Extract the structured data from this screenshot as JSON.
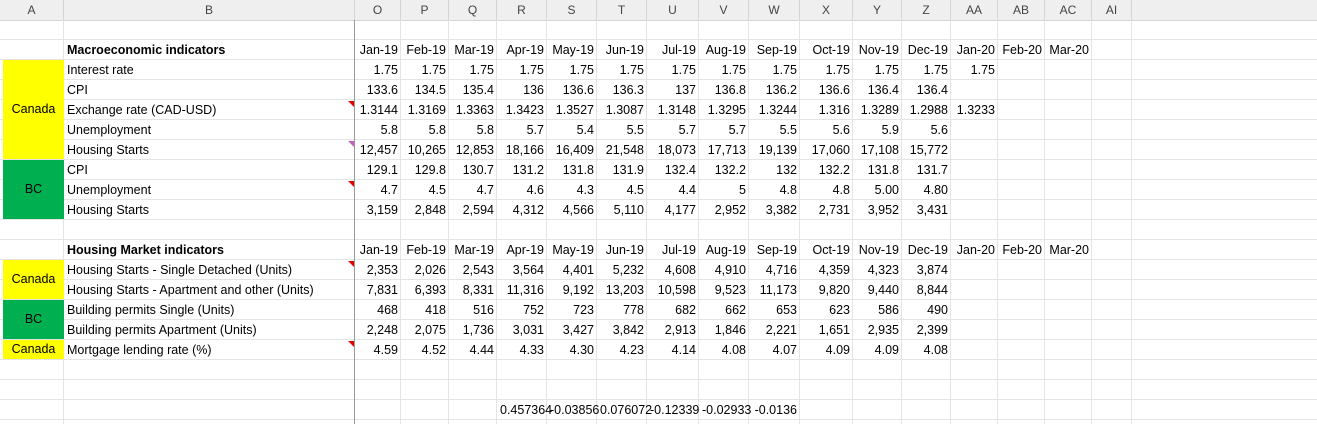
{
  "column_headers": [
    "A",
    "B",
    "O",
    "P",
    "Q",
    "R",
    "S",
    "T",
    "U",
    "V",
    "W",
    "X",
    "Y",
    "Z",
    "AA",
    "AB",
    "AC",
    "AI"
  ],
  "macro": {
    "title": "Macroeconomic indicators",
    "months": [
      "Jan-19",
      "Feb-19",
      "Mar-19",
      "Apr-19",
      "May-19",
      "Jun-19",
      "Jul-19",
      "Aug-19",
      "Sep-19",
      "Oct-19",
      "Nov-19",
      "Dec-19",
      "Jan-20",
      "Feb-20",
      "Mar-20"
    ],
    "regions": [
      "Canada",
      "BC"
    ],
    "rows": [
      {
        "label": "Interest rate",
        "values": [
          "1.75",
          "1.75",
          "1.75",
          "1.75",
          "1.75",
          "1.75",
          "1.75",
          "1.75",
          "1.75",
          "1.75",
          "1.75",
          "1.75",
          "1.75",
          "",
          ""
        ]
      },
      {
        "label": "CPI",
        "values": [
          "133.6",
          "134.5",
          "135.4",
          "136",
          "136.6",
          "136.3",
          "137",
          "136.8",
          "136.2",
          "136.6",
          "136.4",
          "136.4",
          "",
          "",
          ""
        ]
      },
      {
        "label": "Exchange rate (CAD-USD)",
        "values": [
          "1.3144",
          "1.3169",
          "1.3363",
          "1.3423",
          "1.3527",
          "1.3087",
          "1.3148",
          "1.3295",
          "1.3244",
          "1.316",
          "1.3289",
          "1.2988",
          "1.3233",
          "",
          ""
        ]
      },
      {
        "label": "Unemployment",
        "values": [
          "5.8",
          "5.8",
          "5.8",
          "5.7",
          "5.4",
          "5.5",
          "5.7",
          "5.7",
          "5.5",
          "5.6",
          "5.9",
          "5.6",
          "",
          "",
          ""
        ]
      },
      {
        "label": "Housing Starts",
        "values": [
          "12,457",
          "10,265",
          "12,853",
          "18,166",
          "16,409",
          "21,548",
          "18,073",
          "17,713",
          "19,139",
          "17,060",
          "17,108",
          "15,772",
          "",
          "",
          ""
        ]
      },
      {
        "label": "CPI",
        "values": [
          "129.1",
          "129.8",
          "130.7",
          "131.2",
          "131.8",
          "131.9",
          "132.4",
          "132.2",
          "132",
          "132.2",
          "131.8",
          "131.7",
          "",
          "",
          ""
        ]
      },
      {
        "label": "Unemployment",
        "values": [
          "4.7",
          "4.5",
          "4.7",
          "4.6",
          "4.3",
          "4.5",
          "4.4",
          "5",
          "4.8",
          "4.8",
          "5.00",
          "4.80",
          "",
          "",
          ""
        ]
      },
      {
        "label": "Housing Starts",
        "values": [
          "3,159",
          "2,848",
          "2,594",
          "4,312",
          "4,566",
          "5,110",
          "4,177",
          "2,952",
          "3,382",
          "2,731",
          "3,952",
          "3,431",
          "",
          "",
          ""
        ]
      }
    ]
  },
  "housing": {
    "title": "Housing Market indicators",
    "months": [
      "Jan-19",
      "Feb-19",
      "Mar-19",
      "Apr-19",
      "May-19",
      "Jun-19",
      "Jul-19",
      "Aug-19",
      "Sep-19",
      "Oct-19",
      "Nov-19",
      "Dec-19",
      "Jan-20",
      "Feb-20",
      "Mar-20"
    ],
    "regions": [
      "Canada",
      "BC",
      "Canada"
    ],
    "rows": [
      {
        "label": "Housing Starts - Single Detached (Units)",
        "values": [
          "2,353",
          "2,026",
          "2,543",
          "3,564",
          "4,401",
          "5,232",
          "4,608",
          "4,910",
          "4,716",
          "4,359",
          "4,323",
          "3,874",
          "",
          "",
          ""
        ]
      },
      {
        "label": "Housing Starts - Apartment and other (Units)",
        "values": [
          "7,831",
          "6,393",
          "8,331",
          "11,316",
          "9,192",
          "13,203",
          "10,598",
          "9,523",
          "11,173",
          "9,820",
          "9,440",
          "8,844",
          "",
          "",
          ""
        ]
      },
      {
        "label": "Building permits Single (Units)",
        "values": [
          "468",
          "418",
          "516",
          "752",
          "723",
          "778",
          "682",
          "662",
          "653",
          "623",
          "586",
          "490",
          "",
          "",
          ""
        ]
      },
      {
        "label": "Building permits Apartment (Units)",
        "values": [
          "2,248",
          "2,075",
          "1,736",
          "3,031",
          "3,427",
          "3,842",
          "2,913",
          "1,846",
          "2,221",
          "1,651",
          "2,935",
          "2,399",
          "",
          "",
          ""
        ]
      },
      {
        "label": "Mortgage lending rate (%)",
        "values": [
          "4.59",
          "4.52",
          "4.44",
          "4.33",
          "4.30",
          "4.23",
          "4.14",
          "4.08",
          "4.07",
          "4.09",
          "4.09",
          "4.08",
          "",
          "",
          ""
        ]
      }
    ]
  },
  "correlations": [
    "0.457364",
    "-0.03856",
    "0.076072",
    "-0.12339",
    "-0.02933",
    "-0.0136"
  ],
  "colors": {
    "canada": "#ffff00",
    "bc": "#00b050",
    "comment_red": "#e00000",
    "comment_purple": "#c060c0"
  }
}
